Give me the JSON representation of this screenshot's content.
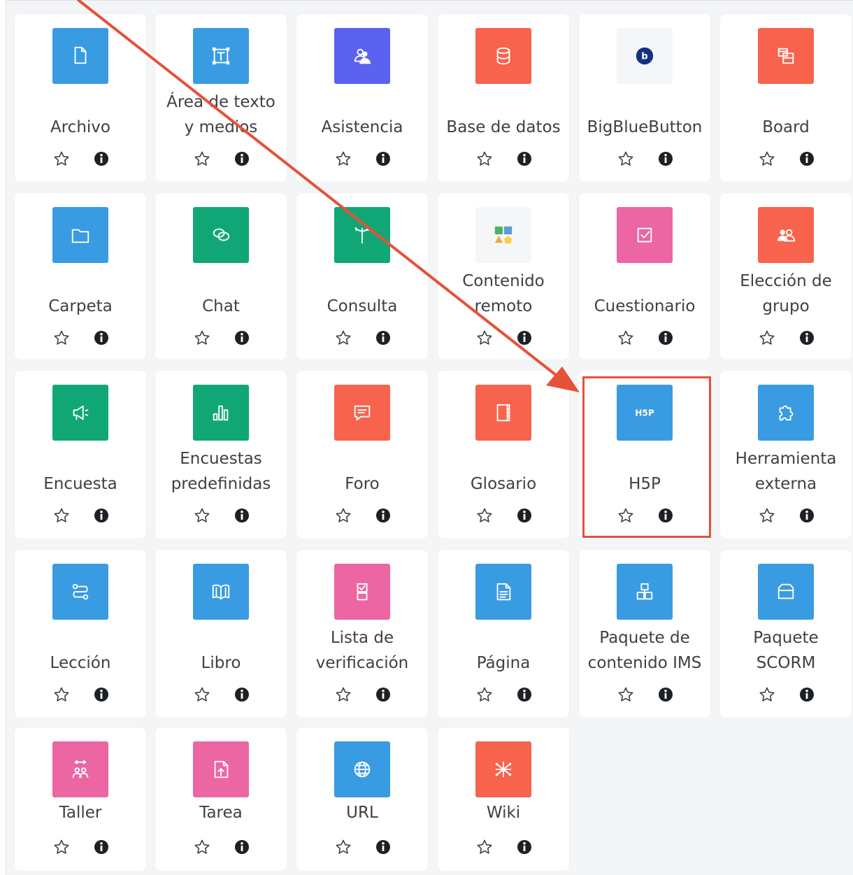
{
  "colors": {
    "blue": "#399be2",
    "red": "#f7634d",
    "purple": "#5b62ef",
    "green": "#11a676",
    "pink": "#eb66a2",
    "highlight": "#e6513a"
  },
  "activities": [
    {
      "label": "Archivo",
      "icon": "file-icon",
      "color": "blue"
    },
    {
      "label": "Área de texto y medios",
      "icon": "text-area-icon",
      "color": "blue"
    },
    {
      "label": "Asistencia",
      "icon": "attendance-icon",
      "color": "purple"
    },
    {
      "label": "Base de datos",
      "icon": "database-icon",
      "color": "red"
    },
    {
      "label": "BigBlueButton",
      "icon": "bigbluebutton-icon",
      "color": "white"
    },
    {
      "label": "Board",
      "icon": "board-icon",
      "color": "red"
    },
    {
      "label": "Carpeta",
      "icon": "folder-icon",
      "color": "blue"
    },
    {
      "label": "Chat",
      "icon": "chat-icon",
      "color": "green"
    },
    {
      "label": "Consulta",
      "icon": "choice-icon",
      "color": "green"
    },
    {
      "label": "Contenido remoto",
      "icon": "remote-content-icon",
      "color": "white"
    },
    {
      "label": "Cuestionario",
      "icon": "quiz-icon",
      "color": "pink"
    },
    {
      "label": "Elección de grupo",
      "icon": "group-choice-icon",
      "color": "red"
    },
    {
      "label": "Encuesta",
      "icon": "survey-icon",
      "color": "green"
    },
    {
      "label": "Encuestas predefinidas",
      "icon": "feedback-chart-icon",
      "color": "green"
    },
    {
      "label": "Foro",
      "icon": "forum-icon",
      "color": "red"
    },
    {
      "label": "Glosario",
      "icon": "glossary-icon",
      "color": "red"
    },
    {
      "label": "H5P",
      "icon": "h5p-icon",
      "color": "blue",
      "badge": "H5P"
    },
    {
      "label": "Herramienta externa",
      "icon": "puzzle-icon",
      "color": "blue"
    },
    {
      "label": "Lección",
      "icon": "lesson-icon",
      "color": "blue"
    },
    {
      "label": "Libro",
      "icon": "book-icon",
      "color": "blue"
    },
    {
      "label": "Lista de verificación",
      "icon": "checklist-icon",
      "color": "pink"
    },
    {
      "label": "Página",
      "icon": "page-icon",
      "color": "blue"
    },
    {
      "label": "Paquete de contenido IMS",
      "icon": "ims-package-icon",
      "color": "blue"
    },
    {
      "label": "Paquete SCORM",
      "icon": "scorm-icon",
      "color": "blue"
    },
    {
      "label": "Taller",
      "icon": "workshop-icon",
      "color": "pink"
    },
    {
      "label": "Tarea",
      "icon": "assignment-icon",
      "color": "pink"
    },
    {
      "label": "URL",
      "icon": "globe-icon",
      "color": "blue"
    },
    {
      "label": "Wiki",
      "icon": "wiki-icon",
      "color": "red"
    }
  ]
}
